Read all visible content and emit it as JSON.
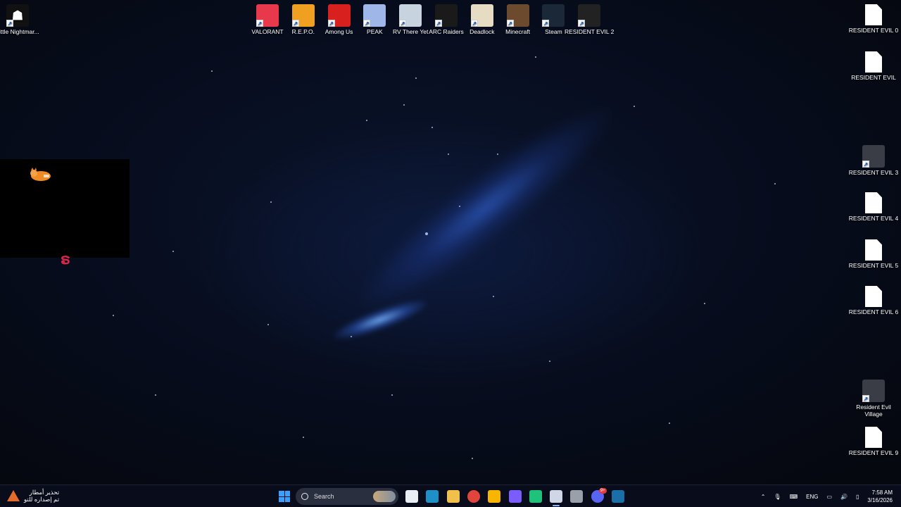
{
  "desktop": {
    "top_left_icon": {
      "label": "Little Nightmar...",
      "icon": "little-nightmares-icon"
    },
    "top_icons": [
      {
        "label": "VALORANT",
        "icon": "valorant-icon",
        "color": "#e8394c"
      },
      {
        "label": "R.E.P.O.",
        "icon": "repo-icon",
        "color": "#f0a020"
      },
      {
        "label": "Among Us",
        "icon": "among-us-icon",
        "color": "#d8201e"
      },
      {
        "label": "PEAK",
        "icon": "peak-icon",
        "color": "#9fb7e8"
      },
      {
        "label": "RV There Yet",
        "icon": "rv-there-yet-icon",
        "color": "#c7d3de"
      },
      {
        "label": "ARC Raiders",
        "icon": "arc-raiders-icon",
        "color": "#1a1a1a"
      },
      {
        "label": "Deadlock",
        "icon": "deadlock-icon",
        "color": "#e6dcc3"
      },
      {
        "label": "Minecraft",
        "icon": "minecraft-icon",
        "color": "#6b4a2e"
      },
      {
        "label": "Steam",
        "icon": "steam-icon",
        "color": "#1b2838"
      },
      {
        "label": "RESIDENT EVIL 2",
        "icon": "resident-evil-2-icon",
        "color": "#222"
      }
    ],
    "right_icons": [
      {
        "label": "RESIDENT EVIL 0",
        "icon": "file-icon"
      },
      {
        "label": "RESIDENT EVIL",
        "icon": "file-icon"
      },
      {
        "label": "RESIDENT EVIL 3",
        "icon": "resident-evil-3-icon"
      },
      {
        "label": "RESIDENT EVIL 4",
        "icon": "file-icon"
      },
      {
        "label": "RESIDENT EVIL 5",
        "icon": "file-icon"
      },
      {
        "label": "RESIDENT EVIL 6",
        "icon": "file-icon"
      },
      {
        "label": "Resident Evil Village",
        "icon": "resident-evil-village-icon"
      },
      {
        "label": "RESIDENT EVIL 9",
        "icon": "file-icon"
      }
    ]
  },
  "taskbar": {
    "weather_line1": "تحذير أمطار",
    "weather_line2": "تم إصداره للتو",
    "search_label": "Search",
    "language": "ENG",
    "time": "7:58 AM",
    "date": "3/16/2026",
    "discord_badge": "9+",
    "apps": [
      {
        "name": "file-explorer-app",
        "color": "#e9eef5"
      },
      {
        "name": "edge-app",
        "color": "#1e90c8"
      },
      {
        "name": "folder-app",
        "color": "#f1c04a"
      },
      {
        "name": "chrome-app",
        "color": "#e0443a"
      },
      {
        "name": "rockstar-app",
        "color": "#f7b500"
      },
      {
        "name": "copilot-app",
        "color": "#7a5cff"
      },
      {
        "name": "voice-app",
        "color": "#1fc27a"
      },
      {
        "name": "obs-app",
        "color": "#cfd6e6"
      },
      {
        "name": "chat-app",
        "color": "#9aa0aa"
      },
      {
        "name": "discord-app",
        "color": "#5865f2"
      },
      {
        "name": "steam-tray-app",
        "color": "#1b6fa8"
      }
    ]
  }
}
